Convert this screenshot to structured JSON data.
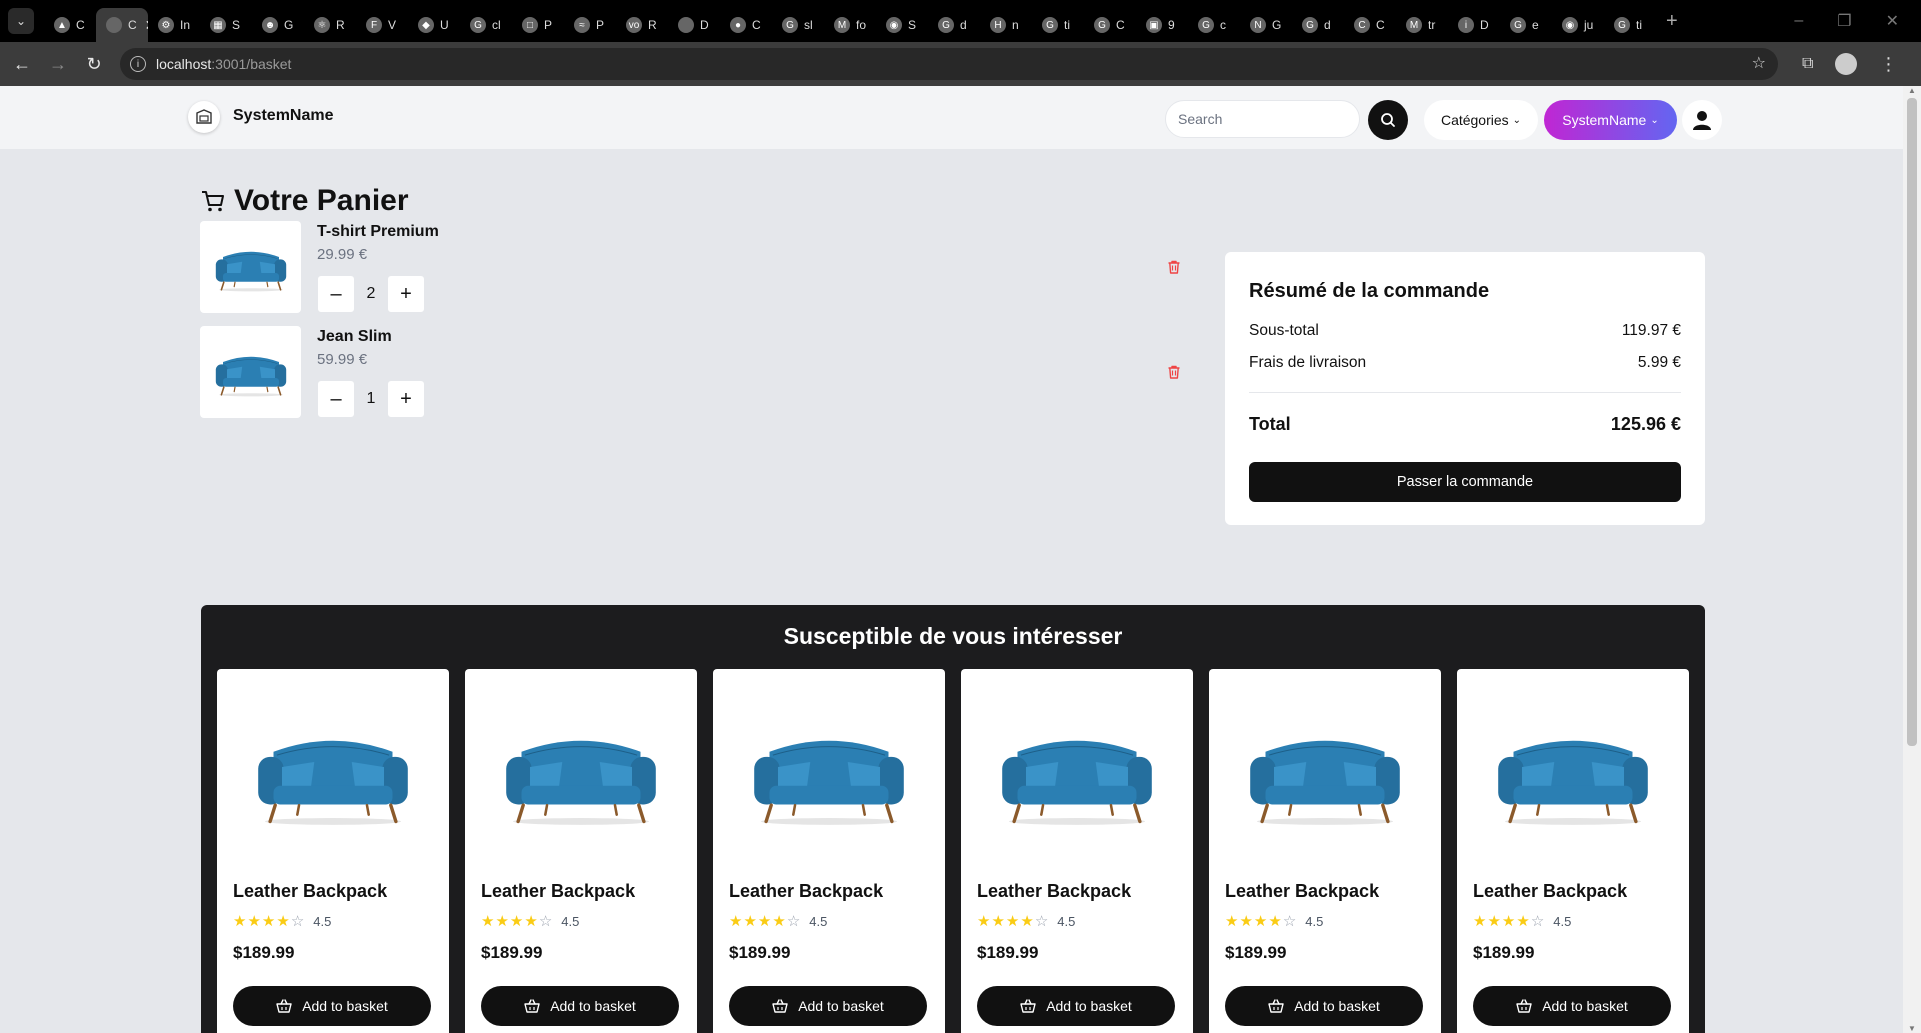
{
  "browser": {
    "tabs": [
      {
        "icon": "▲",
        "label": "C",
        "active": false
      },
      {
        "icon": "",
        "label": "C",
        "active": true
      },
      {
        "icon": "⚙",
        "label": "In",
        "active": false
      },
      {
        "icon": "▦",
        "label": "S",
        "active": false
      },
      {
        "icon": "☻",
        "label": "G",
        "active": false
      },
      {
        "icon": "⚛",
        "label": "R",
        "active": false
      },
      {
        "icon": "F",
        "label": "V",
        "active": false
      },
      {
        "icon": "◆",
        "label": "U",
        "active": false
      },
      {
        "icon": "G",
        "label": "cl",
        "active": false
      },
      {
        "icon": "□",
        "label": "P",
        "active": false
      },
      {
        "icon": "≈",
        "label": "P",
        "active": false
      },
      {
        "icon": "vo",
        "label": "R",
        "active": false
      },
      {
        "icon": "",
        "label": "D",
        "active": false
      },
      {
        "icon": "●",
        "label": "C",
        "active": false
      },
      {
        "icon": "G",
        "label": "sl",
        "active": false
      },
      {
        "icon": "M",
        "label": "fo",
        "active": false
      },
      {
        "icon": "◉",
        "label": "S",
        "active": false
      },
      {
        "icon": "G",
        "label": "d",
        "active": false
      },
      {
        "icon": "H",
        "label": "n",
        "active": false
      },
      {
        "icon": "G",
        "label": "ti",
        "active": false
      },
      {
        "icon": "G",
        "label": "C",
        "active": false
      },
      {
        "icon": "▣",
        "label": "9",
        "active": false
      },
      {
        "icon": "G",
        "label": "c",
        "active": false
      },
      {
        "icon": "N",
        "label": "G",
        "active": false
      },
      {
        "icon": "G",
        "label": "d",
        "active": false
      },
      {
        "icon": "C",
        "label": "C",
        "active": false
      },
      {
        "icon": "M",
        "label": "tr",
        "active": false
      },
      {
        "icon": "i",
        "label": "D",
        "active": false
      },
      {
        "icon": "G",
        "label": "e",
        "active": false
      },
      {
        "icon": "◉",
        "label": "ju",
        "active": false
      },
      {
        "icon": "G",
        "label": "ti",
        "active": false
      }
    ],
    "url_host": "localhost",
    "url_path": ":3001/basket"
  },
  "header": {
    "brand": "SystemName",
    "search_placeholder": "Search",
    "categories_label": "Catégories",
    "system_menu_label": "SystemName"
  },
  "basket": {
    "title": "Votre Panier",
    "items": [
      {
        "name": "T-shirt Premium",
        "price": "29.99 €",
        "quantity": "2"
      },
      {
        "name": "Jean Slim",
        "price": "59.99 €",
        "quantity": "1"
      }
    ]
  },
  "summary": {
    "title": "Résumé de la commande",
    "subtotal_label": "Sous-total",
    "subtotal_value": "119.97 €",
    "shipping_label": "Frais de livraison",
    "shipping_value": "5.99 €",
    "total_label": "Total",
    "total_value": "125.96 €",
    "checkout_label": "Passer la commande"
  },
  "recommendations": {
    "title": "Susceptible de vous intéresser",
    "products": [
      {
        "name": "Leather Backpack",
        "rating": "4.5",
        "rating_value": 4.5,
        "price": "$189.99",
        "button": "Add to basket"
      },
      {
        "name": "Leather Backpack",
        "rating": "4.5",
        "rating_value": 4.5,
        "price": "$189.99",
        "button": "Add to basket"
      },
      {
        "name": "Leather Backpack",
        "rating": "4.5",
        "rating_value": 4.5,
        "price": "$189.99",
        "button": "Add to basket"
      },
      {
        "name": "Leather Backpack",
        "rating": "4.5",
        "rating_value": 4.5,
        "price": "$189.99",
        "button": "Add to basket"
      },
      {
        "name": "Leather Backpack",
        "rating": "4.5",
        "rating_value": 4.5,
        "price": "$189.99",
        "button": "Add to basket"
      },
      {
        "name": "Leather Backpack",
        "rating": "4.5",
        "rating_value": 4.5,
        "price": "$189.99",
        "button": "Add to basket"
      }
    ]
  },
  "colors": {
    "page_bg": "#e5e7eb",
    "dark": "#111111",
    "danger": "#ef4444",
    "star": "#facc15",
    "sofa": "#2b7fb3",
    "accent_gradient_start": "#c026d3",
    "accent_gradient_end": "#6366f1"
  }
}
